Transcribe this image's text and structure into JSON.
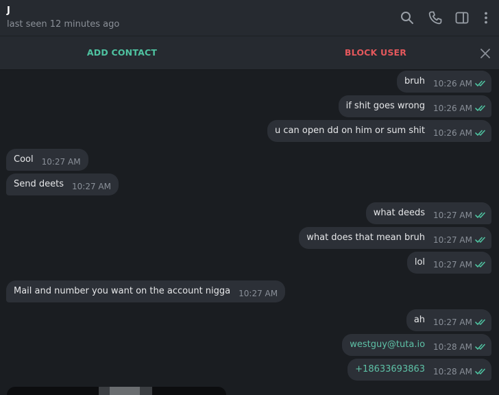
{
  "header": {
    "name": "J",
    "status": "last seen 12 minutes ago",
    "icons": [
      "search-icon",
      "phone-icon",
      "sidebar-toggle-icon",
      "more-vertical-icon"
    ]
  },
  "actions": {
    "add_contact": "ADD CONTACT",
    "block_user": "BLOCK USER",
    "close_icon": "close-icon"
  },
  "colors": {
    "accent_green": "#4fc3a1",
    "danger_red": "#e5585c",
    "bubble_bg": "#2c3037",
    "chat_bg": "#1a1d21",
    "header_bg": "#262a30"
  },
  "messages": [
    {
      "dir": "out",
      "text": "bruh",
      "time": "10:26 AM",
      "read": true
    },
    {
      "dir": "out",
      "text": "if shit goes wrong",
      "time": "10:26 AM",
      "read": true
    },
    {
      "dir": "out",
      "text": "u can open dd on him or sum shit",
      "time": "10:26 AM",
      "read": true
    },
    {
      "dir": "in",
      "text": "Cool",
      "time": "10:27 AM"
    },
    {
      "dir": "in",
      "text": "Send deets",
      "time": "10:27 AM"
    },
    {
      "dir": "out",
      "text": "what deeds",
      "time": "10:27 AM",
      "read": true
    },
    {
      "dir": "out",
      "text": "what does that mean bruh",
      "time": "10:27 AM",
      "read": true
    },
    {
      "dir": "out",
      "text": "lol",
      "time": "10:27 AM",
      "read": true
    },
    {
      "dir": "in",
      "text": "Mail and number you want on the account nigga",
      "time": "10:27 AM"
    },
    {
      "dir": "out",
      "text": "ah",
      "time": "10:27 AM",
      "read": true
    },
    {
      "dir": "out",
      "text": "westguy@tuta.io",
      "time": "10:28 AM",
      "read": true,
      "link": true
    },
    {
      "dir": "out",
      "text": "+18633693863",
      "time": "10:28 AM",
      "read": true,
      "link": true
    }
  ]
}
